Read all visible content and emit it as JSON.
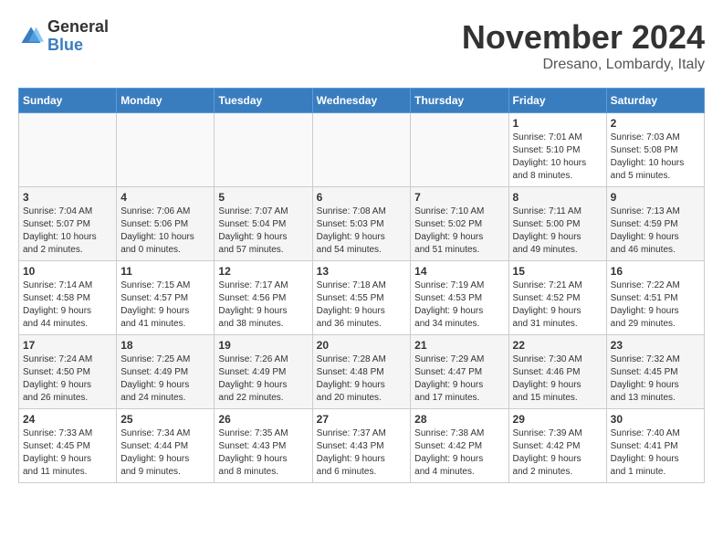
{
  "header": {
    "logo": {
      "general": "General",
      "blue": "Blue"
    },
    "title": "November 2024",
    "location": "Dresano, Lombardy, Italy"
  },
  "calendar": {
    "days_of_week": [
      "Sunday",
      "Monday",
      "Tuesday",
      "Wednesday",
      "Thursday",
      "Friday",
      "Saturday"
    ],
    "weeks": [
      {
        "shaded": false,
        "days": [
          {
            "date": "",
            "info": ""
          },
          {
            "date": "",
            "info": ""
          },
          {
            "date": "",
            "info": ""
          },
          {
            "date": "",
            "info": ""
          },
          {
            "date": "",
            "info": ""
          },
          {
            "date": "1",
            "info": "Sunrise: 7:01 AM\nSunset: 5:10 PM\nDaylight: 10 hours\nand 8 minutes."
          },
          {
            "date": "2",
            "info": "Sunrise: 7:03 AM\nSunset: 5:08 PM\nDaylight: 10 hours\nand 5 minutes."
          }
        ]
      },
      {
        "shaded": true,
        "days": [
          {
            "date": "3",
            "info": "Sunrise: 7:04 AM\nSunset: 5:07 PM\nDaylight: 10 hours\nand 2 minutes."
          },
          {
            "date": "4",
            "info": "Sunrise: 7:06 AM\nSunset: 5:06 PM\nDaylight: 10 hours\nand 0 minutes."
          },
          {
            "date": "5",
            "info": "Sunrise: 7:07 AM\nSunset: 5:04 PM\nDaylight: 9 hours\nand 57 minutes."
          },
          {
            "date": "6",
            "info": "Sunrise: 7:08 AM\nSunset: 5:03 PM\nDaylight: 9 hours\nand 54 minutes."
          },
          {
            "date": "7",
            "info": "Sunrise: 7:10 AM\nSunset: 5:02 PM\nDaylight: 9 hours\nand 51 minutes."
          },
          {
            "date": "8",
            "info": "Sunrise: 7:11 AM\nSunset: 5:00 PM\nDaylight: 9 hours\nand 49 minutes."
          },
          {
            "date": "9",
            "info": "Sunrise: 7:13 AM\nSunset: 4:59 PM\nDaylight: 9 hours\nand 46 minutes."
          }
        ]
      },
      {
        "shaded": false,
        "days": [
          {
            "date": "10",
            "info": "Sunrise: 7:14 AM\nSunset: 4:58 PM\nDaylight: 9 hours\nand 44 minutes."
          },
          {
            "date": "11",
            "info": "Sunrise: 7:15 AM\nSunset: 4:57 PM\nDaylight: 9 hours\nand 41 minutes."
          },
          {
            "date": "12",
            "info": "Sunrise: 7:17 AM\nSunset: 4:56 PM\nDaylight: 9 hours\nand 38 minutes."
          },
          {
            "date": "13",
            "info": "Sunrise: 7:18 AM\nSunset: 4:55 PM\nDaylight: 9 hours\nand 36 minutes."
          },
          {
            "date": "14",
            "info": "Sunrise: 7:19 AM\nSunset: 4:53 PM\nDaylight: 9 hours\nand 34 minutes."
          },
          {
            "date": "15",
            "info": "Sunrise: 7:21 AM\nSunset: 4:52 PM\nDaylight: 9 hours\nand 31 minutes."
          },
          {
            "date": "16",
            "info": "Sunrise: 7:22 AM\nSunset: 4:51 PM\nDaylight: 9 hours\nand 29 minutes."
          }
        ]
      },
      {
        "shaded": true,
        "days": [
          {
            "date": "17",
            "info": "Sunrise: 7:24 AM\nSunset: 4:50 PM\nDaylight: 9 hours\nand 26 minutes."
          },
          {
            "date": "18",
            "info": "Sunrise: 7:25 AM\nSunset: 4:49 PM\nDaylight: 9 hours\nand 24 minutes."
          },
          {
            "date": "19",
            "info": "Sunrise: 7:26 AM\nSunset: 4:49 PM\nDaylight: 9 hours\nand 22 minutes."
          },
          {
            "date": "20",
            "info": "Sunrise: 7:28 AM\nSunset: 4:48 PM\nDaylight: 9 hours\nand 20 minutes."
          },
          {
            "date": "21",
            "info": "Sunrise: 7:29 AM\nSunset: 4:47 PM\nDaylight: 9 hours\nand 17 minutes."
          },
          {
            "date": "22",
            "info": "Sunrise: 7:30 AM\nSunset: 4:46 PM\nDaylight: 9 hours\nand 15 minutes."
          },
          {
            "date": "23",
            "info": "Sunrise: 7:32 AM\nSunset: 4:45 PM\nDaylight: 9 hours\nand 13 minutes."
          }
        ]
      },
      {
        "shaded": false,
        "days": [
          {
            "date": "24",
            "info": "Sunrise: 7:33 AM\nSunset: 4:45 PM\nDaylight: 9 hours\nand 11 minutes."
          },
          {
            "date": "25",
            "info": "Sunrise: 7:34 AM\nSunset: 4:44 PM\nDaylight: 9 hours\nand 9 minutes."
          },
          {
            "date": "26",
            "info": "Sunrise: 7:35 AM\nSunset: 4:43 PM\nDaylight: 9 hours\nand 8 minutes."
          },
          {
            "date": "27",
            "info": "Sunrise: 7:37 AM\nSunset: 4:43 PM\nDaylight: 9 hours\nand 6 minutes."
          },
          {
            "date": "28",
            "info": "Sunrise: 7:38 AM\nSunset: 4:42 PM\nDaylight: 9 hours\nand 4 minutes."
          },
          {
            "date": "29",
            "info": "Sunrise: 7:39 AM\nSunset: 4:42 PM\nDaylight: 9 hours\nand 2 minutes."
          },
          {
            "date": "30",
            "info": "Sunrise: 7:40 AM\nSunset: 4:41 PM\nDaylight: 9 hours\nand 1 minute."
          }
        ]
      }
    ]
  }
}
